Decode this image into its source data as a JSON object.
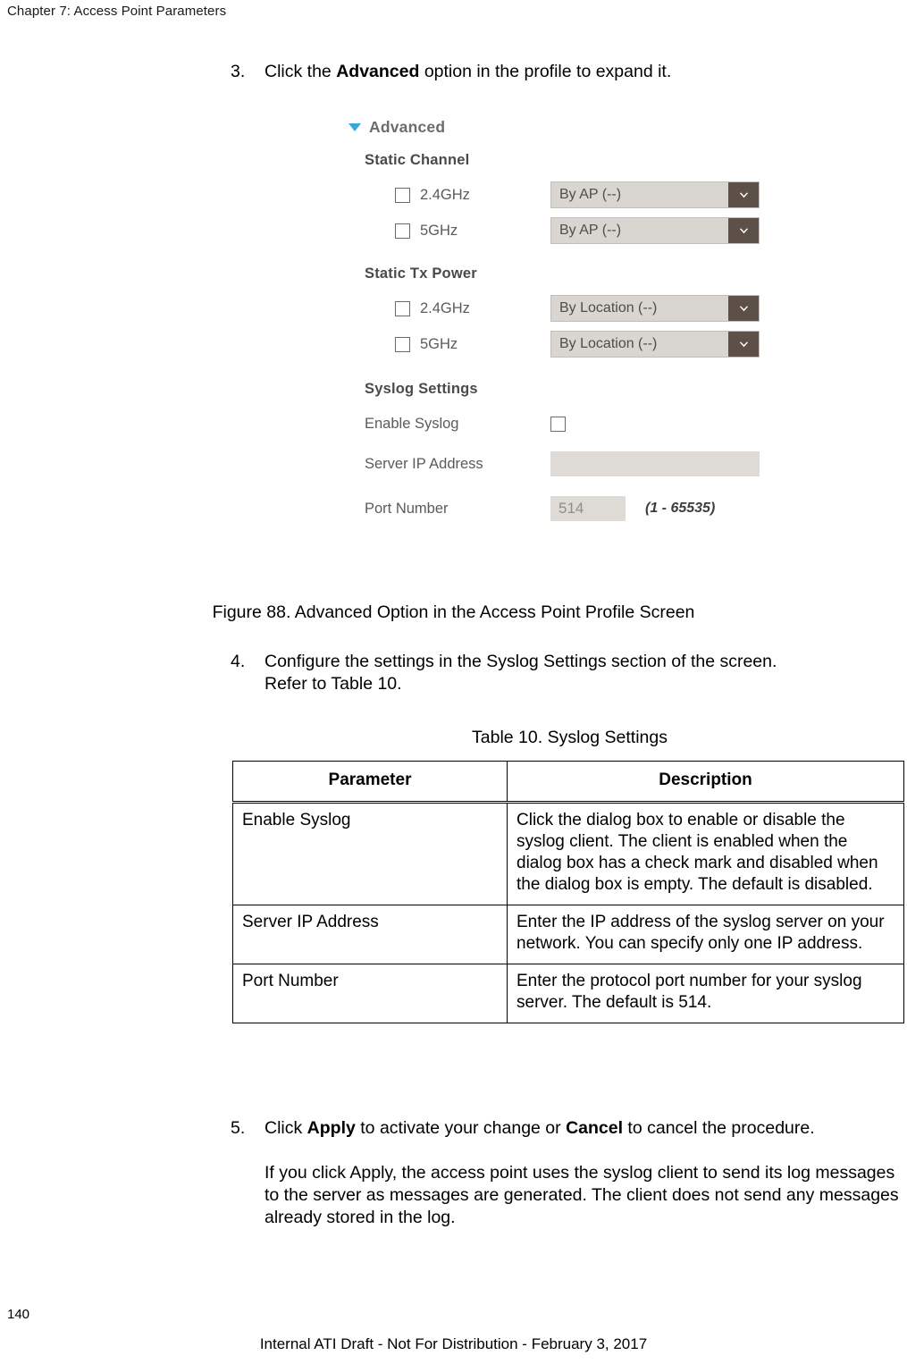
{
  "header": {
    "chapter": "Chapter 7: Access Point Parameters"
  },
  "steps": {
    "step3": {
      "num": "3.",
      "pre": "Click the ",
      "bold": "Advanced",
      "post": " option in the profile to expand it."
    },
    "step4": {
      "num": "4.",
      "line1": "Configure the settings in the Syslog Settings section of the screen.",
      "line2": "Refer to Table 10."
    },
    "step5": {
      "num": "5.",
      "pre": "Click ",
      "bold1": "Apply",
      "mid": " to activate your change or ",
      "bold2": "Cancel",
      "post": " to cancel the procedure.",
      "para": "If you click Apply, the access point uses the syslog client to send its log messages to the server as messages are generated. The client does not send any messages already stored in the log."
    }
  },
  "figure": {
    "caption": "Figure 88. Advanced Option in the Access Point Profile Screen",
    "advanced_label": "Advanced",
    "sections": {
      "static_channel": {
        "title": "Static Channel",
        "rows": [
          {
            "label": "2.4GHz",
            "value": "By AP (--)"
          },
          {
            "label": "5GHz",
            "value": "By AP (--)"
          }
        ]
      },
      "static_tx_power": {
        "title": "Static Tx Power",
        "rows": [
          {
            "label": "2.4GHz",
            "value": "By Location (--)"
          },
          {
            "label": "5GHz",
            "value": "By Location (--)"
          }
        ]
      },
      "syslog_settings": {
        "title": "Syslog Settings",
        "enable_label": "Enable Syslog",
        "server_ip_label": "Server IP Address",
        "server_ip_value": "",
        "port_label": "Port Number",
        "port_value": "514",
        "port_hint": "(1 - 65535)"
      }
    },
    "colors": {
      "triangle": "#35a8dd",
      "dropdown_body": "#d9d5d1",
      "dropdown_button": "#5c5048",
      "input_bg": "#dedad6",
      "label_text": "#5d5b58"
    }
  },
  "table": {
    "caption": "Table 10. Syslog Settings",
    "columns": [
      "Parameter",
      "Description"
    ],
    "rows": [
      {
        "parameter": "Enable Syslog",
        "description": "Click the dialog box to enable or disable the syslog client. The client is enabled when the dialog box has a check mark and disabled when the dialog box is empty. The default is disabled."
      },
      {
        "parameter": "Server IP Address",
        "description": "Enter the IP address of the syslog server on your network. You can specify only one IP address."
      },
      {
        "parameter": "Port Number",
        "description": "Enter the protocol port number for your syslog server. The default is 514."
      }
    ]
  },
  "footer": {
    "page_number": "140",
    "notice": "Internal ATI Draft - Not For Distribution - February 3, 2017"
  }
}
